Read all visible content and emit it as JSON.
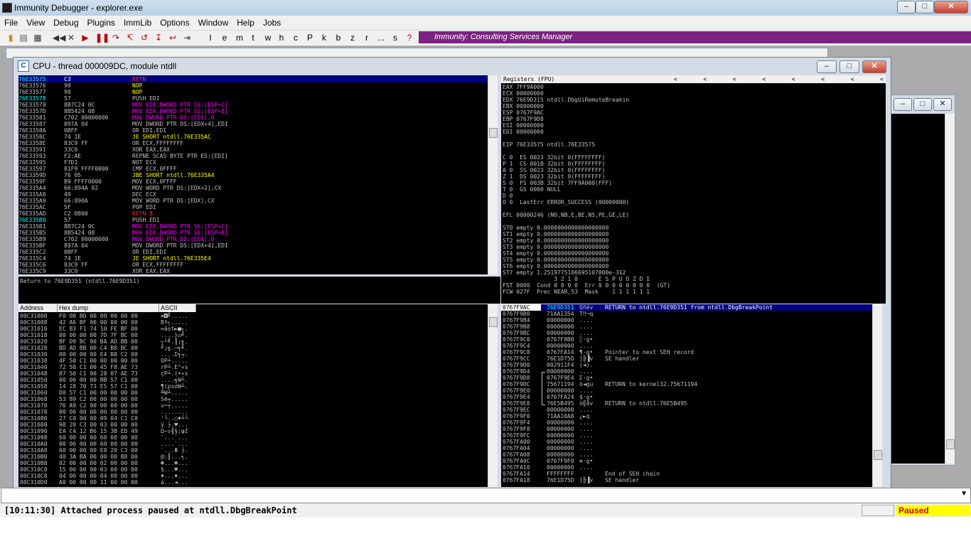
{
  "window": {
    "title": "Immunity Debugger - explorer.exe",
    "min": "–",
    "max": "□",
    "close": "✕"
  },
  "menu": [
    "File",
    "View",
    "Debug",
    "Plugins",
    "ImmLib",
    "Options",
    "Window",
    "Help",
    "Jobs"
  ],
  "toolbar": {
    "letters": [
      "l",
      "e",
      "m",
      "t",
      "w",
      "h",
      "c",
      "P",
      "k",
      "b",
      "z",
      "r",
      "...",
      "s",
      "?"
    ],
    "banner": "Immunity: Consulting Services Manager"
  },
  "cpu_window": {
    "title": "CPU - thread 000009DC, module ntdll",
    "icon": "C"
  },
  "disasm": [
    {
      "a": "76E33575",
      "h": "C3",
      "i": "RETN",
      "c": "red",
      "sel": true
    },
    {
      "a": "76E33576",
      "h": "90",
      "i": "NOP",
      "c": "yellow"
    },
    {
      "a": "76E33577",
      "h": "90",
      "i": "NOP",
      "c": "yellow"
    },
    {
      "a": "76E33578",
      "h": "57",
      "i": "PUSH EDI",
      "c": "gray",
      "cyanaddr": true
    },
    {
      "a": "76E33579",
      "h": "8B7C24 0C",
      "i": "MOV EDI,DWORD PTR SS:[ESP+C]",
      "c": "mix"
    },
    {
      "a": "76E3357D",
      "h": "8B5424 08",
      "i": "MOV EDX,DWORD PTR SS:[ESP+8]",
      "c": "mix"
    },
    {
      "a": "76E33581",
      "h": "C702 00000000",
      "i": "MOV DWORD PTR DS:[EDX],0",
      "c": "mix"
    },
    {
      "a": "76E33587",
      "h": "897A 04",
      "i": "MOV DWORD PTR DS:[EDX+4],EDI",
      "c": "gray"
    },
    {
      "a": "76E3358A",
      "h": "0BFF",
      "i": "OR EDI,EDI",
      "c": "gray"
    },
    {
      "a": "76E3358C",
      "h": "74 1E",
      "i": "JE SHORT ntdll.76E335AC",
      "c": "jmp"
    },
    {
      "a": "76E3358E",
      "h": "83C9 FF",
      "i": "OR ECX,FFFFFFFF",
      "c": "gray"
    },
    {
      "a": "76E33591",
      "h": "33C0",
      "i": "XOR EAX,EAX",
      "c": "gray"
    },
    {
      "a": "76E33593",
      "h": "F2:AE",
      "i": "REPNE SCAS BYTE PTR ES:[EDI]",
      "c": "gray"
    },
    {
      "a": "76E33595",
      "h": "F7D1",
      "i": "NOT ECX",
      "c": "gray"
    },
    {
      "a": "76E33597",
      "h": "81F9 FFFF0000",
      "i": "CMP ECX,0FFFF",
      "c": "gray"
    },
    {
      "a": "76E3359D",
      "h": "76 05",
      "i": "JBE SHORT ntdll.76E335A4",
      "c": "jmp"
    },
    {
      "a": "76E3359F",
      "h": "B9 FFFF0000",
      "i": "MOV ECX,0FFFF",
      "c": "gray"
    },
    {
      "a": "76E335A4",
      "h": "66:894A 02",
      "i": "MOV WORD PTR DS:[EDX+2],CX",
      "c": "gray"
    },
    {
      "a": "76E335A8",
      "h": "49",
      "i": "DEC ECX",
      "c": "gray"
    },
    {
      "a": "76E335A9",
      "h": "66:890A",
      "i": "MOV WORD PTR DS:[EDX],CX",
      "c": "gray"
    },
    {
      "a": "76E335AC",
      "h": "5F",
      "i": "POP EDI",
      "c": "gray"
    },
    {
      "a": "76E335AD",
      "h": "C2 0800",
      "i": "RETN 8",
      "c": "red"
    },
    {
      "a": "76E335B0",
      "h": "57",
      "i": "PUSH EDI",
      "c": "gray",
      "cyanaddr": true
    },
    {
      "a": "76E335B1",
      "h": "8B7C24 0C",
      "i": "MOV EDI,DWORD PTR SS:[ESP+C]",
      "c": "mix"
    },
    {
      "a": "76E335B5",
      "h": "8B5424 08",
      "i": "MOV EDX,DWORD PTR SS:[ESP+8]",
      "c": "mix"
    },
    {
      "a": "76E335B9",
      "h": "C702 00000000",
      "i": "MOV DWORD PTR DS:[EDX],0",
      "c": "mix"
    },
    {
      "a": "76E335BF",
      "h": "897A 04",
      "i": "MOV DWORD PTR DS:[EDX+4],EDI",
      "c": "gray"
    },
    {
      "a": "76E335C2",
      "h": "0BFF",
      "i": "OR EDI,EDI",
      "c": "gray"
    },
    {
      "a": "76E335C4",
      "h": "74 1E",
      "i": "JE SHORT ntdll.76E335E4",
      "c": "jmp"
    },
    {
      "a": "76E335C6",
      "h": "83C9 FF",
      "i": "OR ECX,FFFFFFFF",
      "c": "gray"
    },
    {
      "a": "76E335C9",
      "h": "33C0",
      "i": "XOR EAX,EAX",
      "c": "gray"
    }
  ],
  "info_line": "Return to 76E9D351 (ntdll.76E9D351)",
  "registers": {
    "header": "Registers (FPU)",
    "arrows": "<  <  <  <  <  <  <  <  <  <",
    "lines": [
      "EAX 7FF9A000",
      "ECX 00000000",
      "EDX 76E9D315 ntdll.DbgUiRemoteBreakin",
      "EBX 00000000",
      "ESP 0767F9AC",
      "EBP 0767F9D8",
      "ESI 00000000",
      "EDI 00000000",
      "",
      "EIP 76E33575 ntdll.76E33575",
      "",
      "C 0  ES 0023 32bit 0(FFFFFFFF)",
      "P 1  CS 001B 32bit 0(FFFFFFFF)",
      "A 0  SS 0023 32bit 0(FFFFFFFF)",
      "Z 1  DS 0023 32bit 0(FFFFFFFF)",
      "S 0  FS 003B 32bit 7FF9A000(FFF)",
      "T 0  GS 0000 NULL",
      "D 0",
      "O 0  LastErr ERROR_SUCCESS (00000000)",
      "",
      "EFL 00000246 (NO,NB,E,BE,NS,PE,GE,LE)",
      "",
      "ST0 empty 0.0000000000000000000",
      "ST1 empty 0.0000000000000000000",
      "ST2 empty 0.0000000000000000000",
      "ST3 empty 0.0000000000000000000",
      "ST4 empty 0.0000000000000000000",
      "ST5 empty 0.0000000000000000000",
      "ST6 empty 0.0000000000000000000",
      "ST7 empty 1.2519775166695107000e-312",
      "               3 2 1 0      E S P U O Z D I",
      "FST 0000  Cond 0 0 0 0  Err 0 0 0 0 0 0 0 0  (GT)",
      "FCW 027F  Prec NEAR,53  Mask    1 1 1 1 1 1"
    ]
  },
  "dump": {
    "headers": [
      "Address",
      "Hex dump",
      "ASCII"
    ],
    "rows": [
      [
        "00C31000",
        "F0 08 BD 00 00 00 00 00",
        "≡◘╝....."
      ],
      [
        "00C31008",
        "42 A6 BF 00 00 00 00 00",
        "Bª┐....."
      ],
      [
        "00C31010",
        "EC 83 F1 74 10 FE BF 00",
        "∞â±t►■┐."
      ],
      [
        "00C31018",
        "00 00 00 00 7D 7F BC 00",
        "....}⌂╝."
      ],
      [
        "00C31020",
        "BF D9 BC 00 BA AD BB 00",
        "┐┘╝.║¡╗."
      ],
      [
        "00C31028",
        "BD AD BB 00 C4 B8 BC 00",
        "╜¡╗.─╕╝."
      ],
      [
        "00C31030",
        "00 00 00 00 E4 B8 C2 00",
        "....Σ╕┬."
      ],
      [
        "00C31038",
        "4F 50 C1 00 00 00 00 00",
        "OP┴....."
      ],
      [
        "00C31040",
        "72 50 C1 00 45 F8 AE 73",
        "rP┴.E°«s"
      ],
      [
        "00C31048",
        "87 50 C1 00 28 07 AE 73",
        "çP┴.(•«s"
      ],
      [
        "00C31050",
        "00 00 00 00 BB 57 C1 00",
        "....╗W┴."
      ],
      [
        "00C31058",
        "14 28 70 73 E5 57 C1 00",
        "¶(psσW┴."
      ],
      [
        "00C31060",
        "D0 57 C1 00 00 00 00 00",
        "╨W┴....."
      ],
      [
        "00C31068",
        "53 89 C2 00 00 00 00 00",
        "Së┬....."
      ],
      [
        "00C31070",
        "76 A9 C2 00 00 00 00 00",
        "v⌐┬....."
      ],
      [
        "00C31078",
        "00 00 00 00 00 00 00 00",
        "........"
      ],
      [
        "00C31080",
        "27 C0 00 00 09 04 C1 C0",
        "'└..○♦┴└"
      ],
      [
        "00C31088",
        "98 20 C3 00 03 00 00 00",
        "ÿ ├.♥..."
      ],
      [
        "00C31090",
        "EA C4 12 B6 15 3B ED 49",
        "Ω─↕╢§;φI"
      ],
      [
        "00C31098",
        "60 00 00 00 60 00 00 00",
        "`...`..."
      ],
      [
        "00C310A0",
        "00 00 00 00 60 00 00 00",
        "....`..."
      ],
      [
        "00C310A8",
        "60 00 00 00 E8 20 C3 00",
        "`...Φ ├."
      ],
      [
        "00C310B0",
        "40 3A BA 00 00 00 B8 00",
        "@:║...╕."
      ],
      [
        "00C310B8",
        "02 00 00 00 02 00 00 00",
        "☻...☻..."
      ],
      [
        "00C310C0",
        "15 00 00 00 03 00 00 00",
        "§...♥..."
      ],
      [
        "00C310C8",
        "04 00 00 00 04 00 00 00",
        "♦...♦..."
      ],
      [
        "00C310D0",
        "A0 00 00 00 11 00 00 00",
        "á...◄..."
      ]
    ]
  },
  "stack": [
    {
      "a": "0767F9AC",
      "v": "76E9D351",
      "t": "Qñév",
      "c": "RETURN to ntdll.76E9D351 from ntdll.DbgBreakPoint",
      "sel": true
    },
    {
      "a": "0767F9B0",
      "v": "71AA1354",
      "t": "T‼¬q",
      "c": ""
    },
    {
      "a": "0767F9B4",
      "v": "00000000",
      "t": "....",
      "c": ""
    },
    {
      "a": "0767F9B8",
      "v": "00000000",
      "t": "....",
      "c": ""
    },
    {
      "a": "0767F9BC",
      "v": "00000000",
      "t": "....",
      "c": ""
    },
    {
      "a": "0767F9C0",
      "v": "0767F9B0",
      "t": "░·g•",
      "c": ""
    },
    {
      "a": "0767F9C4",
      "v": "00000000",
      "t": "....",
      "c": ""
    },
    {
      "a": "0767F9C8",
      "v": "0767FA14",
      "t": "¶·g•",
      "c": "Pointer to next SEH record"
    },
    {
      "a": "0767F9CC",
      "v": "76E1D75D",
      "t": "]╠▐v",
      "c": "SE handler"
    },
    {
      "a": "0767F9D0",
      "v": "002911F4",
      "t": "(◄).",
      "c": ""
    },
    {
      "a": "0767F9D4",
      "v": "00000000",
      "t": "....",
      "c": ""
    },
    {
      "a": "0767F9D8",
      "v": "0767F9E4",
      "t": "Σ·g•",
      "c": ""
    },
    {
      "a": "0767F9DC",
      "v": "75671194",
      "t": "ö◄gu",
      "c": "RETURN to kernel32.75671194"
    },
    {
      "a": "0767F9E0",
      "v": "00000000",
      "t": "....",
      "c": ""
    },
    {
      "a": "0767F9E4",
      "v": "0767FA24",
      "t": "$·g•",
      "c": ""
    },
    {
      "a": "0767F9E8",
      "v": "76E5B495",
      "t": "ò╣åv",
      "c": "RETURN to ntdll.76E5B495"
    },
    {
      "a": "0767F9EC",
      "v": "00000000",
      "t": "....",
      "c": ""
    },
    {
      "a": "0767F9F0",
      "v": "71AA10A8",
      "t": "¿►q",
      "c": ""
    },
    {
      "a": "0767F9F4",
      "v": "00000000",
      "t": "....",
      "c": ""
    },
    {
      "a": "0767F9F8",
      "v": "00000000",
      "t": "....",
      "c": ""
    },
    {
      "a": "0767F9FC",
      "v": "00000000",
      "t": "....",
      "c": ""
    },
    {
      "a": "0767FA00",
      "v": "00000000",
      "t": "....",
      "c": ""
    },
    {
      "a": "0767FA04",
      "v": "00000000",
      "t": "....",
      "c": ""
    },
    {
      "a": "0767FA08",
      "v": "00000000",
      "t": "....",
      "c": ""
    },
    {
      "a": "0767FA0C",
      "v": "0767F9F0",
      "t": "≡·g•",
      "c": ""
    },
    {
      "a": "0767FA10",
      "v": "00000000",
      "t": "....",
      "c": ""
    },
    {
      "a": "0767FA14",
      "v": "FFFFFFFF",
      "t": "",
      "c": "End of SEH chain"
    },
    {
      "a": "0767FA18",
      "v": "76E1D75D",
      "t": "]╠▐v",
      "c": "SE handler"
    }
  ],
  "status": {
    "message": "[10:11:30] Attached process paused at ntdll.DbgBreakPoint",
    "state": "Paused"
  },
  "colors": {
    "selection": "#000080",
    "banner": "#7a2280",
    "paused_bg": "#ffff00",
    "paused_fg": "#cc0000"
  }
}
